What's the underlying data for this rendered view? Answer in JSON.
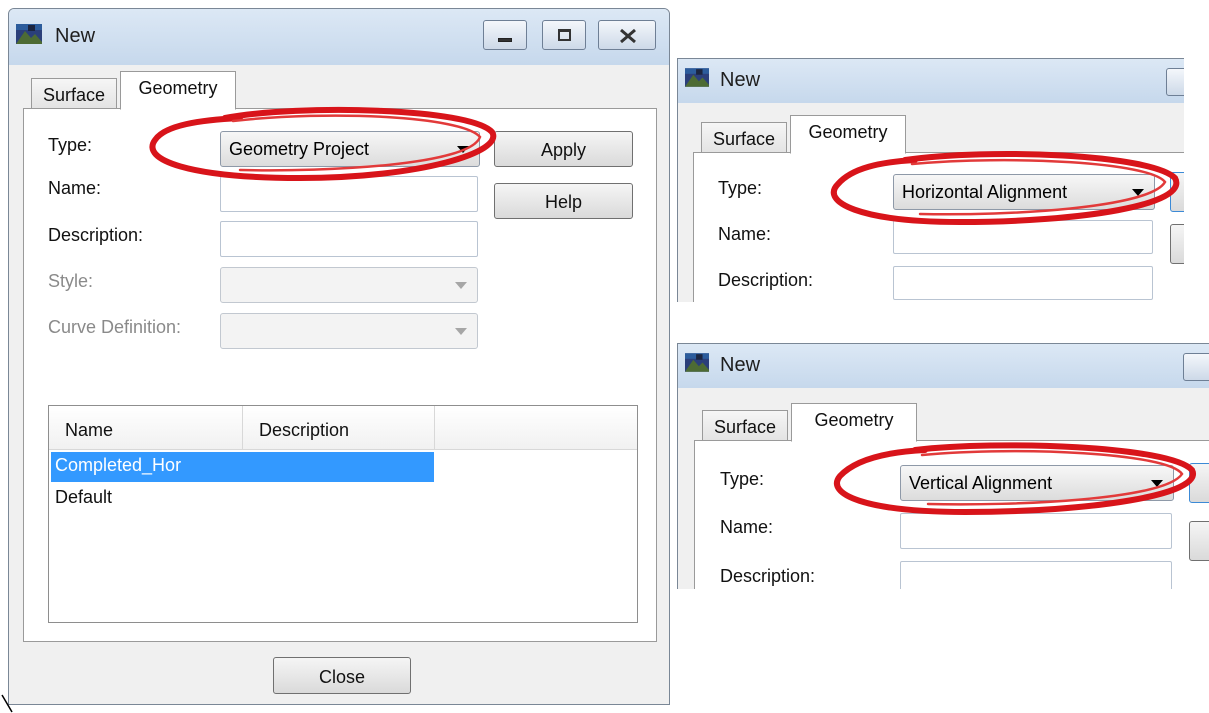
{
  "dialog_main": {
    "title": "New",
    "tabs": [
      {
        "label": "Surface"
      },
      {
        "label": "Geometry"
      }
    ],
    "active_tab": "Geometry",
    "fields": {
      "type_label": "Type:",
      "type_value": "Geometry Project",
      "name_label": "Name:",
      "name_value": "",
      "description_label": "Description:",
      "description_value": "",
      "style_label": "Style:",
      "curve_definition_label": "Curve Definition:"
    },
    "buttons": {
      "apply": "Apply",
      "help": "Help",
      "close": "Close"
    },
    "list": {
      "columns": [
        "Name",
        "Description"
      ],
      "rows": [
        {
          "name": "Completed_Hor",
          "selected": true
        },
        {
          "name": "Default",
          "selected": false
        }
      ]
    }
  },
  "dialog_horizontal": {
    "title": "New",
    "tabs": [
      {
        "label": "Surface"
      },
      {
        "label": "Geometry"
      }
    ],
    "active_tab": "Geometry",
    "fields": {
      "type_label": "Type:",
      "type_value": "Horizontal Alignment",
      "name_label": "Name:",
      "description_label": "Description:"
    }
  },
  "dialog_vertical": {
    "title": "New",
    "tabs": [
      {
        "label": "Surface"
      },
      {
        "label": "Geometry"
      }
    ],
    "active_tab": "Geometry",
    "fields": {
      "type_label": "Type:",
      "type_value": "Vertical Alignment",
      "name_label": "Name:",
      "description_label": "Description:"
    }
  },
  "icons": [
    "app-landscape-icon",
    "minimize-icon",
    "maximize-icon",
    "close-icon",
    "dropdown-arrow-icon"
  ],
  "colors": {
    "highlight_ellipse": "#d8141a",
    "selection": "#3399ff",
    "titlebar": "#c6d8ec",
    "dialog_background": "#f0f0f0"
  }
}
